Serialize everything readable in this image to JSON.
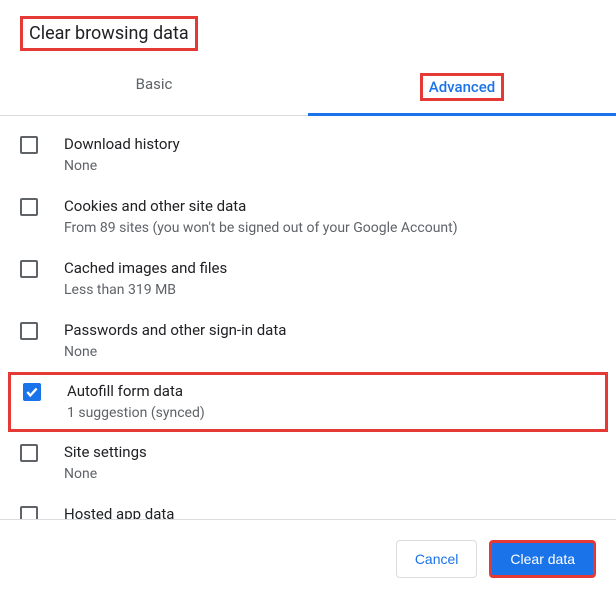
{
  "header": {
    "title": "Clear browsing data"
  },
  "tabs": {
    "basic": "Basic",
    "advanced": "Advanced",
    "active": "advanced"
  },
  "items": [
    {
      "title": "Download history",
      "sub": "None",
      "checked": false
    },
    {
      "title": "Cookies and other site data",
      "sub": "From 89 sites (you won't be signed out of your Google Account)",
      "checked": false
    },
    {
      "title": "Cached images and files",
      "sub": "Less than 319 MB",
      "checked": false
    },
    {
      "title": "Passwords and other sign-in data",
      "sub": "None",
      "checked": false
    },
    {
      "title": "Autofill form data",
      "sub": "1 suggestion (synced)",
      "checked": true,
      "highlight": true
    },
    {
      "title": "Site settings",
      "sub": "None",
      "checked": false
    },
    {
      "title": "Hosted app data",
      "sub": "",
      "checked": false
    }
  ],
  "footer": {
    "cancel": "Cancel",
    "clear": "Clear data"
  },
  "highlight_color": "#e53935"
}
